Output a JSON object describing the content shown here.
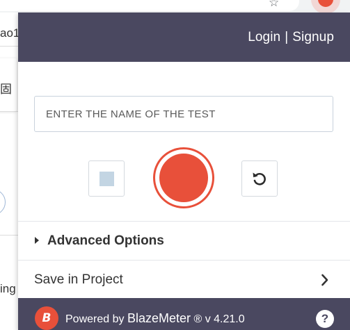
{
  "background": {
    "snippets": [
      "ao1",
      "固",
      "ing"
    ]
  },
  "header": {
    "login_label": "Login",
    "separator": "|",
    "signup_label": "Signup"
  },
  "test_name": {
    "placeholder": "ENTER THE NAME OF THE TEST",
    "value": ""
  },
  "controls": {
    "stop_icon": "stop-icon",
    "record_icon": "record-icon",
    "reset_icon": "reset-icon"
  },
  "advanced": {
    "label": "Advanced Options",
    "icon": "caret-right-icon",
    "expanded": false
  },
  "save": {
    "label": "Save in Project",
    "icon": "chevron-right-icon"
  },
  "footer": {
    "logo_letter": "B",
    "powered_by": "Powered by",
    "brand": "BlazeMeter",
    "version_text": "® v 4.21.0",
    "help_label": "?"
  },
  "colors": {
    "header_bg": "#4a4860",
    "accent": "#e8503a",
    "stop_fill": "#c3d5e3"
  }
}
